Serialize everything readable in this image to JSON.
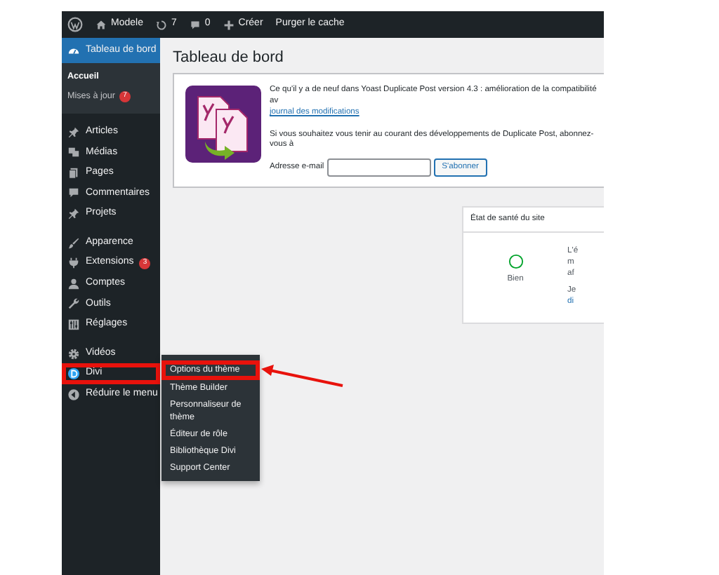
{
  "admin_bar": {
    "items": [
      {
        "kind": "logo"
      },
      {
        "kind": "home",
        "label": "Modele"
      },
      {
        "kind": "updates",
        "label": "7"
      },
      {
        "kind": "comments",
        "label": "0"
      },
      {
        "kind": "new",
        "label": "Créer"
      },
      {
        "kind": "text",
        "label": "Purger le cache"
      }
    ]
  },
  "sidebar": {
    "items": [
      {
        "kind": "dashboard",
        "label": "Tableau de bord",
        "selected": true,
        "children": [
          {
            "label": "Accueil",
            "selected": true
          },
          {
            "label": "Mises à jour",
            "badge": "7",
            "selected": false
          }
        ]
      },
      {
        "kind": "separator"
      },
      {
        "kind": "pin",
        "label": "Articles",
        "selected": false
      },
      {
        "kind": "media",
        "label": "Médias",
        "selected": false
      },
      {
        "kind": "page",
        "label": "Pages",
        "selected": false
      },
      {
        "kind": "comment",
        "label": "Commentaires",
        "selected": false
      },
      {
        "kind": "pin",
        "label": "Projets",
        "selected": false
      },
      {
        "kind": "separator"
      },
      {
        "kind": "brush",
        "label": "Apparence",
        "selected": false
      },
      {
        "kind": "plugin",
        "label": "Extensions",
        "badge": "3",
        "selected": false
      },
      {
        "kind": "user",
        "label": "Comptes",
        "selected": false
      },
      {
        "kind": "wrench",
        "label": "Outils",
        "selected": false
      },
      {
        "kind": "sliders",
        "label": "Réglages",
        "selected": false
      },
      {
        "kind": "separator"
      },
      {
        "kind": "gear",
        "label": "Vidéos",
        "selected": false
      },
      {
        "kind": "divi",
        "label": "Divi",
        "selected": false,
        "highlighted": true,
        "flyout": [
          {
            "label": "Options du thème",
            "highlighted": true
          },
          {
            "label": "Thème Builder",
            "highlighted": false
          },
          {
            "label": "Personnaliseur de thème",
            "highlighted": false
          },
          {
            "label": "Éditeur de rôle",
            "highlighted": false
          },
          {
            "label": "Bibliothèque Divi",
            "highlighted": false
          },
          {
            "label": "Support Center",
            "highlighted": false
          }
        ]
      },
      {
        "kind": "collapse",
        "label": "Réduire le menu",
        "selected": false
      }
    ]
  },
  "main": {
    "title": "Tableau de bord",
    "notice": {
      "headline": "Ce qu'il y a de neuf dans Yoast Duplicate Post version 4.3 : amélioration de la compatibilité av",
      "link": "journal des modifications",
      "text": "Si vous souhaitez vous tenir au courant des développements de Duplicate Post, abonnez-vous à",
      "email_label": "Adresse e-mail",
      "button": "S'abonner"
    },
    "health": {
      "title": "État de santé du site",
      "status": "Bien",
      "fragments": [
        {
          "text": "L'é",
          "kind": "text"
        },
        {
          "text": "m",
          "kind": "text"
        },
        {
          "text": "af",
          "kind": "text"
        },
        {
          "text": "Je",
          "kind": "gap"
        },
        {
          "text": "di",
          "kind": "link"
        }
      ]
    }
  }
}
